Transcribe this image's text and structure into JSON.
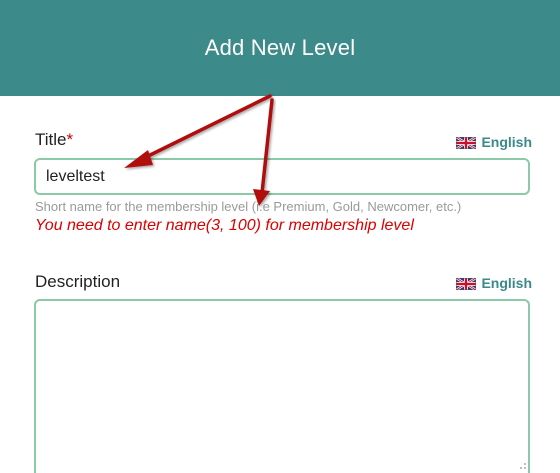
{
  "dialog": {
    "title": "Add New Level"
  },
  "title_field": {
    "label": "Title",
    "required_mark": "*",
    "language": "English",
    "value": "leveltest",
    "hint": "Short name for the membership level (i.e Premium, Gold, Newcomer, etc.)",
    "error": "You need to enter name(3, 100) for membership level"
  },
  "description_field": {
    "label": "Description",
    "language": "English",
    "value": ""
  },
  "colors": {
    "header_bg": "#3d8a8a",
    "input_border": "#8cc9a8",
    "error_text": "#dd0000",
    "annotation_arrow": "#b01010",
    "language_link": "#3a8a8a"
  },
  "icons": {
    "language_flag": "uk-flag-icon",
    "annotation": "red-arrow-annotation"
  }
}
